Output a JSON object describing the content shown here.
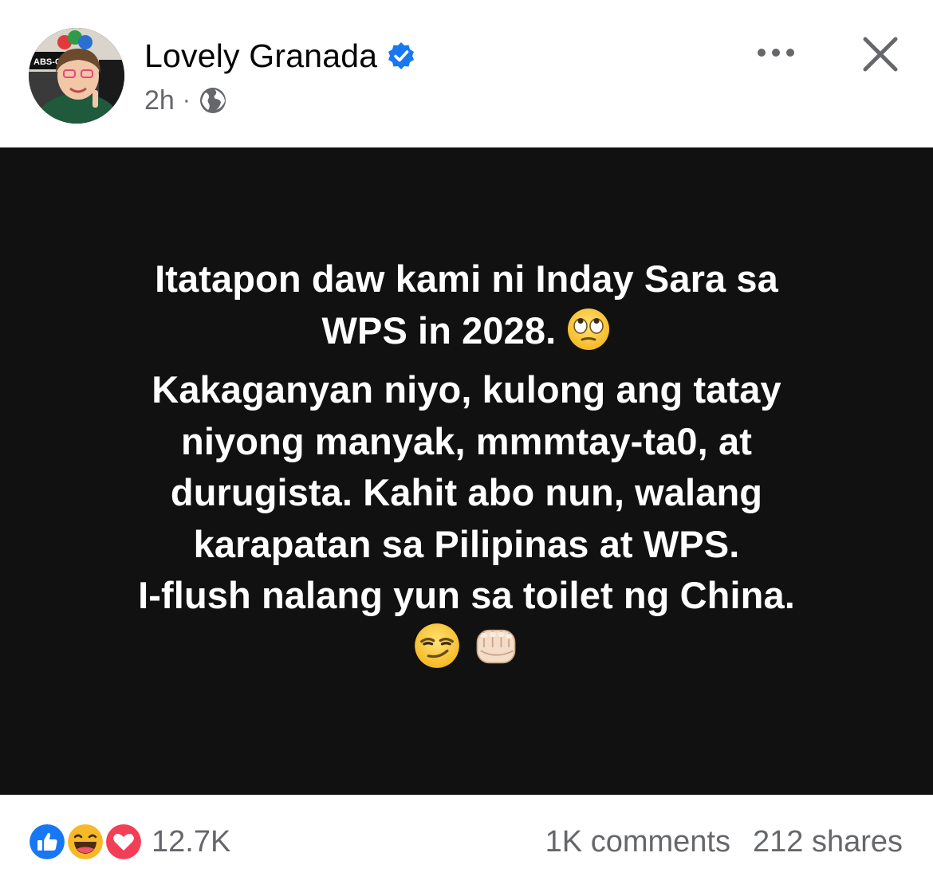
{
  "header": {
    "author_name": "Lovely Granada",
    "time": "2h",
    "separator": "·",
    "avatar_logo_text": "ABS-CBN"
  },
  "post": {
    "lines": [
      "Itatapon daw kami ni Inday Sara sa",
      "WPS in 2028.",
      "Kakaganyan niyo, kulong ang tatay",
      "niyong manyak, mmmtay-ta0, at",
      "durugista. Kahit abo nun, walang",
      "karapatan sa Pilipinas at WPS.",
      "I-flush nalang yun sa toilet ng China."
    ],
    "background_color": "#111111",
    "text_color": "#ffffff"
  },
  "footer": {
    "reaction_count": "12.7K",
    "comments": "1K comments",
    "shares": "212 shares"
  },
  "icons": [
    "verified-badge-icon",
    "globe-icon",
    "more-options-icon",
    "close-icon",
    "eye-roll-emoji",
    "smirk-emoji",
    "fist-bump-emoji",
    "like-reaction-icon",
    "haha-reaction-icon",
    "love-reaction-icon"
  ],
  "colors": {
    "verified_blue": "#1877f2",
    "meta_gray": "#65676b",
    "love_red": "#f33e58",
    "haha_yellow": "#f7b928"
  }
}
